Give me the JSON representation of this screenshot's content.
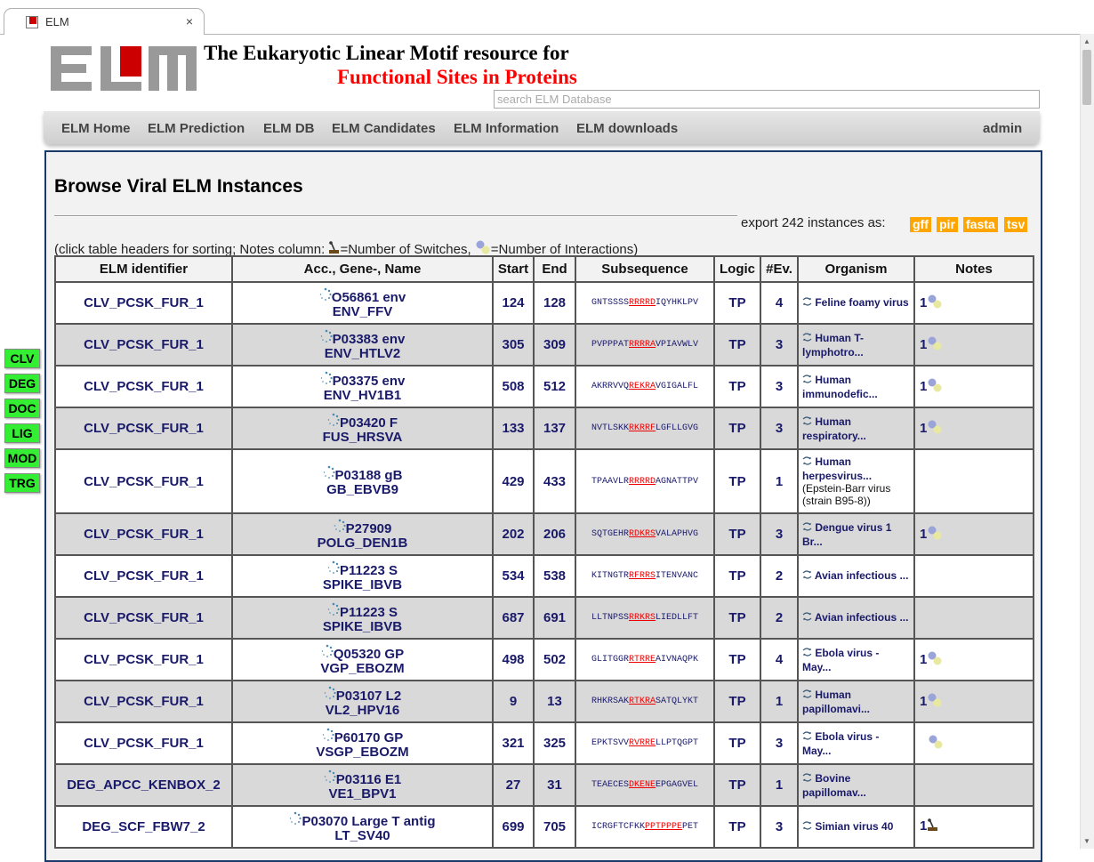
{
  "browser": {
    "tab_title": "ELM",
    "tab_close": "×"
  },
  "header": {
    "title_line1": "The Eukaryotic Linear Motif resource for",
    "title_line2": "Functional Sites in Proteins",
    "search_placeholder": "search ELM Database"
  },
  "nav": {
    "items": [
      "ELM Home",
      "ELM Prediction",
      "ELM DB",
      "ELM Candidates",
      "ELM Information",
      "ELM downloads"
    ],
    "admin": "admin"
  },
  "side_buttons": [
    "CLV",
    "DEG",
    "DOC",
    "LIG",
    "MOD",
    "TRG"
  ],
  "page": {
    "title": "Browse Viral ELM Instances",
    "export_text": "export 242 instances as:",
    "export_formats": [
      "gff",
      "pir",
      "fasta",
      "tsv"
    ],
    "hint_prefix": "(click table headers for sorting; Notes column: ",
    "hint_switches": "=Number of Switches, ",
    "hint_interactions": "=Number of Interactions)"
  },
  "table": {
    "headers": [
      "ELM identifier",
      "Acc., Gene-, Name",
      "Start",
      "End",
      "Subsequence",
      "Logic",
      "#Ev.",
      "Organism",
      "Notes"
    ],
    "rows": [
      {
        "elm": "CLV_PCSK_FUR_1",
        "acc": "O56861 env",
        "gene": "ENV_FFV",
        "start": "124",
        "end": "128",
        "seq_pre": "GNTSSSS",
        "seq_hl": "RRRRD",
        "seq_post": "IQYHKLPV",
        "logic": "TP",
        "ev": "4",
        "org": "Feline foamy virus",
        "org_extra": "",
        "notes": "1",
        "note_icon": "interaction"
      },
      {
        "elm": "CLV_PCSK_FUR_1",
        "acc": "P03383 env",
        "gene": "ENV_HTLV2",
        "start": "305",
        "end": "309",
        "seq_pre": "PVPPPAT",
        "seq_hl": "RRRRA",
        "seq_post": "VPIAVWLV",
        "logic": "TP",
        "ev": "3",
        "org": "Human T-lymphotro...",
        "org_extra": "",
        "notes": "1",
        "note_icon": "interaction"
      },
      {
        "elm": "CLV_PCSK_FUR_1",
        "acc": "P03375 env",
        "gene": "ENV_HV1B1",
        "start": "508",
        "end": "512",
        "seq_pre": "AKRRVVQ",
        "seq_hl": "REKRA",
        "seq_post": "VGIGALFL",
        "logic": "TP",
        "ev": "3",
        "org": "Human immunodefic...",
        "org_extra": "",
        "notes": "1",
        "note_icon": "interaction"
      },
      {
        "elm": "CLV_PCSK_FUR_1",
        "acc": "P03420 F",
        "gene": "FUS_HRSVA",
        "start": "133",
        "end": "137",
        "seq_pre": "NVTLSKK",
        "seq_hl": "RKRRF",
        "seq_post": "LGFLLGVG",
        "logic": "TP",
        "ev": "3",
        "org": "Human respiratory...",
        "org_extra": "",
        "notes": "1",
        "note_icon": "interaction"
      },
      {
        "elm": "CLV_PCSK_FUR_1",
        "acc": "P03188 gB",
        "gene": "GB_EBVB9",
        "start": "429",
        "end": "433",
        "seq_pre": "TPAAVLR",
        "seq_hl": "RRRRD",
        "seq_post": "AGNATTPV",
        "logic": "TP",
        "ev": "1",
        "org": "Human herpesvirus...",
        "org_extra": "(Epstein-Barr virus (strain B95-8))",
        "notes": "",
        "note_icon": ""
      },
      {
        "elm": "CLV_PCSK_FUR_1",
        "acc": "P27909",
        "gene": "POLG_DEN1B",
        "start": "202",
        "end": "206",
        "seq_pre": "SQTGEHR",
        "seq_hl": "RDKRS",
        "seq_post": "VALAPHVG",
        "logic": "TP",
        "ev": "3",
        "org": "Dengue virus 1 Br...",
        "org_extra": "",
        "notes": "1",
        "note_icon": "interaction"
      },
      {
        "elm": "CLV_PCSK_FUR_1",
        "acc": "P11223 S",
        "gene": "SPIKE_IBVB",
        "start": "534",
        "end": "538",
        "seq_pre": "KITNGTR",
        "seq_hl": "RFRRS",
        "seq_post": "ITENVANC",
        "logic": "TP",
        "ev": "2",
        "org": "Avian infectious ...",
        "org_extra": "",
        "notes": "",
        "note_icon": ""
      },
      {
        "elm": "CLV_PCSK_FUR_1",
        "acc": "P11223 S",
        "gene": "SPIKE_IBVB",
        "start": "687",
        "end": "691",
        "seq_pre": "LLTNPSS",
        "seq_hl": "RRKRS",
        "seq_post": "LIEDLLFT",
        "logic": "TP",
        "ev": "2",
        "org": "Avian infectious ...",
        "org_extra": "",
        "notes": "",
        "note_icon": ""
      },
      {
        "elm": "CLV_PCSK_FUR_1",
        "acc": "Q05320 GP",
        "gene": "VGP_EBOZM",
        "start": "498",
        "end": "502",
        "seq_pre": "GLITGGR",
        "seq_hl": "RTRRE",
        "seq_post": "AIVNAQPK",
        "logic": "TP",
        "ev": "4",
        "org": "Ebola virus - May...",
        "org_extra": "",
        "notes": "1",
        "note_icon": "interaction"
      },
      {
        "elm": "CLV_PCSK_FUR_1",
        "acc": "P03107 L2",
        "gene": "VL2_HPV16",
        "start": "9",
        "end": "13",
        "seq_pre": "RHKRSAK",
        "seq_hl": "RTKRA",
        "seq_post": "SATQLYKT",
        "logic": "TP",
        "ev": "1",
        "org": "Human papillomavi...",
        "org_extra": "",
        "notes": "1",
        "note_icon": "interaction"
      },
      {
        "elm": "CLV_PCSK_FUR_1",
        "acc": "P60170 GP",
        "gene": "VSGP_EBOZM",
        "start": "321",
        "end": "325",
        "seq_pre": "EPKTSVV",
        "seq_hl": "RVRRE",
        "seq_post": "LLPTQGPT",
        "logic": "TP",
        "ev": "3",
        "org": "Ebola virus - May...",
        "org_extra": "",
        "notes": "",
        "note_icon": "interaction-only"
      },
      {
        "elm": "DEG_APCC_KENBOX_2",
        "acc": "P03116 E1",
        "gene": "VE1_BPV1",
        "start": "27",
        "end": "31",
        "seq_pre": "TEAECES",
        "seq_hl": "DKENE",
        "seq_post": "EPGAGVEL",
        "logic": "TP",
        "ev": "1",
        "org": "Bovine papillomav...",
        "org_extra": "",
        "notes": "",
        "note_icon": ""
      },
      {
        "elm": "DEG_SCF_FBW7_2",
        "acc": "P03070 Large T antig",
        "gene": "LT_SV40",
        "start": "699",
        "end": "705",
        "seq_pre": "ICRGFTCFKK",
        "seq_hl": "PPTPPPE",
        "seq_post": "PET",
        "logic": "TP",
        "ev": "3",
        "org": "Simian virus 40",
        "org_extra": "",
        "notes": "1",
        "note_icon": "switch"
      }
    ]
  }
}
